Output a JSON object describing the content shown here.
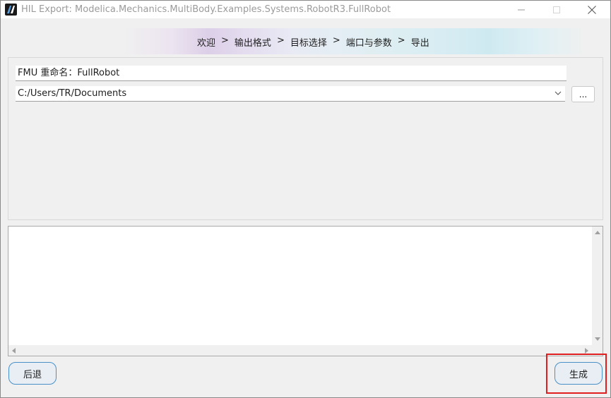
{
  "window": {
    "title": "HIL Export: Modelica.Mechanics.MultiBody.Examples.Systems.RobotR3.FullRobot",
    "app_icon": "app-logo-icon",
    "controls": [
      "minimize-icon",
      "maximize-icon",
      "close-icon"
    ]
  },
  "breadcrumb": {
    "steps": [
      "欢迎",
      "输出格式",
      "目标选择",
      "端口与参数",
      "导出"
    ],
    "separator": ">"
  },
  "form": {
    "rename_value": "FMU 重命名：FullRobot",
    "path_value": "C:/Users/TR/Documents",
    "browse_label": "..."
  },
  "log": {
    "content": ""
  },
  "buttons": {
    "back_label": "后退",
    "generate_label": "生成"
  },
  "colors": {
    "highlight": "#e02020",
    "button_border": "#4a90c8"
  }
}
